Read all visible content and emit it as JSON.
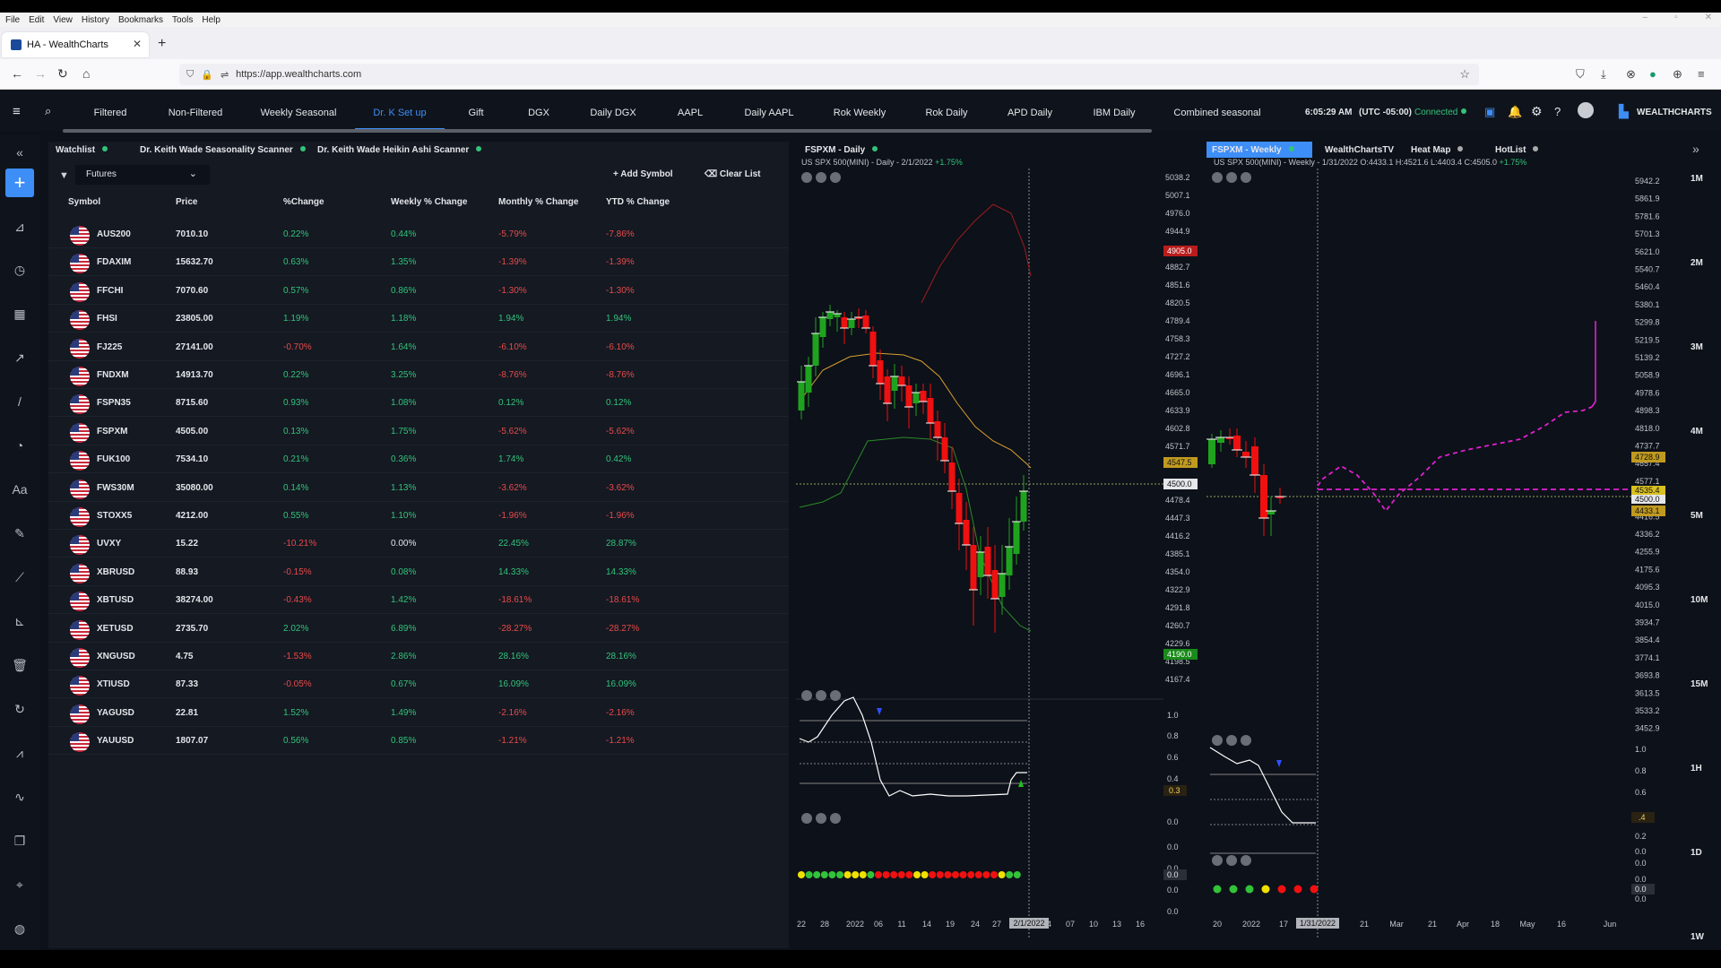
{
  "browser": {
    "menus": [
      "File",
      "Edit",
      "View",
      "History",
      "Bookmarks",
      "Tools",
      "Help"
    ],
    "tab_title": "HA - WealthCharts",
    "url": "https://app.wealthcharts.com"
  },
  "topnav": {
    "items": [
      "Filtered",
      "Non-Filtered",
      "Weekly Seasonal",
      "Dr. K Set up",
      "Gift",
      "DGX",
      "Daily DGX",
      "AAPL",
      "Daily AAPL",
      "Rok Weekly",
      "Rok Daily",
      "APD Daily",
      "IBM Daily",
      "Combined seasonal"
    ],
    "active": "Dr. K Set up",
    "time": "6:05:29 AM",
    "timezone": "(UTC -05:00)",
    "status": "Connected",
    "brand": "WEALTHCHARTS"
  },
  "watchlist": {
    "tabs": [
      "Watchlist",
      "Dr. Keith Wade Seasonality Scanner",
      "Dr. Keith Wade Heikin Ashi Scanner"
    ],
    "selected_list": "Futures",
    "add_symbol": "Add Symbol",
    "clear_list": "Clear List",
    "headers": [
      "Symbol",
      "Price",
      "%Change",
      "Weekly % Change",
      "Monthly % Change",
      "YTD % Change"
    ],
    "rows": [
      {
        "symbol": "AUS200",
        "price": "7010.10",
        "chg": "0.22%",
        "weekly": "0.44%",
        "monthly": "-5.79%",
        "ytd": "-7.86%"
      },
      {
        "symbol": "FDAXIM",
        "price": "15632.70",
        "chg": "0.63%",
        "weekly": "1.35%",
        "monthly": "-1.39%",
        "ytd": "-1.39%"
      },
      {
        "symbol": "FFCHI",
        "price": "7070.60",
        "chg": "0.57%",
        "weekly": "0.86%",
        "monthly": "-1.30%",
        "ytd": "-1.30%"
      },
      {
        "symbol": "FHSI",
        "price": "23805.00",
        "chg": "1.19%",
        "weekly": "1.18%",
        "monthly": "1.94%",
        "ytd": "1.94%"
      },
      {
        "symbol": "FJ225",
        "price": "27141.00",
        "chg": "-0.70%",
        "weekly": "1.64%",
        "monthly": "-6.10%",
        "ytd": "-6.10%"
      },
      {
        "symbol": "FNDXM",
        "price": "14913.70",
        "chg": "0.22%",
        "weekly": "3.25%",
        "monthly": "-8.76%",
        "ytd": "-8.76%"
      },
      {
        "symbol": "FSPN35",
        "price": "8715.60",
        "chg": "0.93%",
        "weekly": "1.08%",
        "monthly": "0.12%",
        "ytd": "0.12%"
      },
      {
        "symbol": "FSPXM",
        "price": "4505.00",
        "chg": "0.13%",
        "weekly": "1.75%",
        "monthly": "-5.62%",
        "ytd": "-5.62%"
      },
      {
        "symbol": "FUK100",
        "price": "7534.10",
        "chg": "0.21%",
        "weekly": "0.36%",
        "monthly": "1.74%",
        "ytd": "0.42%"
      },
      {
        "symbol": "FWS30M",
        "price": "35080.00",
        "chg": "0.14%",
        "weekly": "1.13%",
        "monthly": "-3.62%",
        "ytd": "-3.62%"
      },
      {
        "symbol": "STOXX5",
        "price": "4212.00",
        "chg": "0.55%",
        "weekly": "1.10%",
        "monthly": "-1.96%",
        "ytd": "-1.96%"
      },
      {
        "symbol": "UVXY",
        "price": "15.22",
        "chg": "-10.21%",
        "weekly": "0.00%",
        "monthly": "22.45%",
        "ytd": "28.87%"
      },
      {
        "symbol": "XBRUSD",
        "price": "88.93",
        "chg": "-0.15%",
        "weekly": "0.08%",
        "monthly": "14.33%",
        "ytd": "14.33%"
      },
      {
        "symbol": "XBTUSD",
        "price": "38274.00",
        "chg": "-0.43%",
        "weekly": "1.42%",
        "monthly": "-18.61%",
        "ytd": "-18.61%"
      },
      {
        "symbol": "XETUSD",
        "price": "2735.70",
        "chg": "2.02%",
        "weekly": "6.89%",
        "monthly": "-28.27%",
        "ytd": "-28.27%"
      },
      {
        "symbol": "XNGUSD",
        "price": "4.75",
        "chg": "-1.53%",
        "weekly": "2.86%",
        "monthly": "28.16%",
        "ytd": "28.16%"
      },
      {
        "symbol": "XTIUSD",
        "price": "87.33",
        "chg": "-0.05%",
        "weekly": "0.67%",
        "monthly": "16.09%",
        "ytd": "16.09%"
      },
      {
        "symbol": "YAGUSD",
        "price": "22.81",
        "chg": "1.52%",
        "weekly": "1.49%",
        "monthly": "-2.16%",
        "ytd": "-2.16%"
      },
      {
        "symbol": "YAUUSD",
        "price": "1807.07",
        "chg": "0.56%",
        "weekly": "0.85%",
        "monthly": "-1.21%",
        "ytd": "-1.21%"
      }
    ]
  },
  "daily_chart": {
    "tab": "FSPXM - Daily",
    "info": "US SPX 500(MINI) - Daily - 2/1/2022",
    "info_chg": "+1.75%",
    "yaxis": [
      "5038.2",
      "5007.1",
      "4976.0",
      "4944.9",
      "4913.8",
      "4882.7",
      "4851.6",
      "4820.5",
      "4789.4",
      "4758.3",
      "4727.2",
      "4696.1",
      "4665.0",
      "4633.9",
      "4602.8",
      "4571.7",
      "4540.6",
      "4509.5",
      "4478.4",
      "4447.3",
      "4416.2",
      "4385.1",
      "4354.0",
      "4322.9",
      "4291.8",
      "4260.7",
      "4229.6",
      "4198.5",
      "4167.4"
    ],
    "badges": {
      "upper": "4905.0",
      "mid": "4547.5",
      "cursor": "4500.0",
      "lower": "4190.0"
    },
    "osc_axis": [
      "1.0",
      "0.8",
      "0.6",
      "0.4",
      "0.3",
      "0.0",
      "0.0",
      "0.0",
      "0.0",
      "0.0"
    ],
    "osc_badge": "0.3",
    "dots_badge": "0.0",
    "xaxis": [
      "22",
      "28",
      "2022",
      "06",
      "11",
      "14",
      "19",
      "24",
      "27",
      "04",
      "07",
      "10",
      "13",
      "16"
    ],
    "xaxis_highlight": "2/1/2022"
  },
  "weekly_chart": {
    "tabs": [
      "FSPXM - Weekly",
      "WealthChartsTV",
      "Heat Map",
      "HotList"
    ],
    "info": "US SPX 500(MINI) - Weekly - 1/31/2022 O:4433.1 H:4521.6 L:4403.4 C:4505.0",
    "info_chg": "+1.75%",
    "yaxis": [
      "5942.2",
      "5861.9",
      "5781.6",
      "5701.3",
      "5621.0",
      "5540.7",
      "5460.4",
      "5380.1",
      "5299.8",
      "5219.5",
      "5139.2",
      "5058.9",
      "4978.6",
      "4898.3",
      "4818.0",
      "4737.7",
      "4657.4",
      "4577.1",
      "4496.8",
      "4416.5",
      "4336.2",
      "4255.9",
      "4175.6",
      "4095.3",
      "4015.0",
      "3934.7",
      "3854.4",
      "3774.1",
      "3693.8",
      "3613.5",
      "3533.2",
      "3452.9"
    ],
    "badges": {
      "upper": "4728.9",
      "mid": "4535.4",
      "cursor": "4500.0",
      "lower": "4433.1"
    },
    "osc_axis": [
      "1.0",
      "0.8",
      "0.6",
      "0.4",
      "0.2",
      "0.0",
      "0.0",
      "0.0",
      "0.0"
    ],
    "osc_badge": ".4",
    "dots_badge": "0.0",
    "xaxis": [
      "20",
      "2022",
      "17",
      "21",
      "Mar",
      "21",
      "Apr",
      "18",
      "May",
      "16",
      "Jun"
    ],
    "xaxis_highlight": "1/31/2022"
  },
  "timeframes": [
    "1M",
    "2M",
    "3M",
    "4M",
    "5M",
    "10M",
    "15M",
    "1H",
    "1D",
    "1W"
  ],
  "colors": {
    "accent": "#3e8ef7",
    "up": "#1fa31f",
    "down": "#f01010",
    "magenta": "#e020d0"
  }
}
